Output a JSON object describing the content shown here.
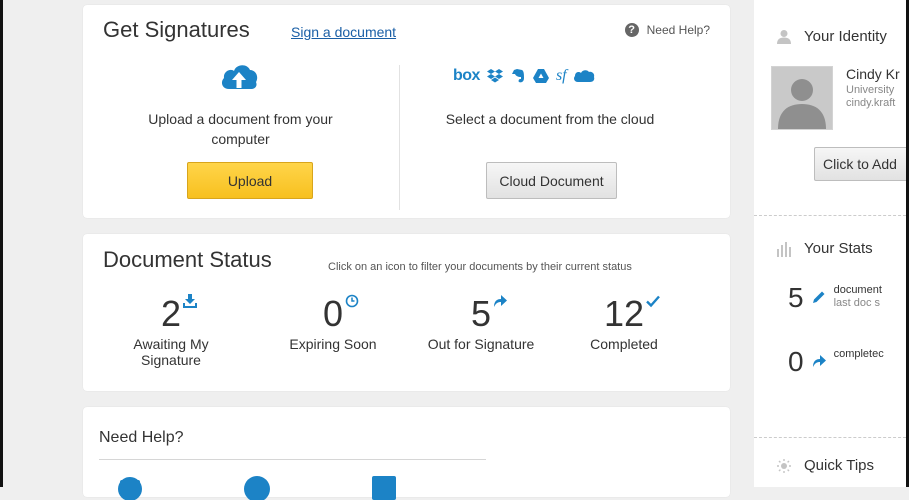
{
  "get_signatures": {
    "title": "Get Signatures",
    "sign_link": "Sign a document",
    "help_label": "Need Help?",
    "help_icon": "?",
    "upload_text": "Upload a document from your computer",
    "upload_button": "Upload",
    "cloud_text": "Select a document from the cloud",
    "cloud_button": "Cloud Document",
    "cloud_providers": [
      "box",
      "dropbox-icon",
      "evernote-icon",
      "google-drive-icon",
      "sharefile-icon",
      "salesforce-icon"
    ],
    "box_label": "box",
    "sharefile_label": "sf"
  },
  "document_status": {
    "title": "Document Status",
    "hint": "Click on an icon to filter your documents by their current status",
    "stats": [
      {
        "count": "2",
        "label": "Awaiting My Signature",
        "icon": "inbox-download-icon"
      },
      {
        "count": "0",
        "label": "Expiring Soon",
        "icon": "clock-icon"
      },
      {
        "count": "5",
        "label": "Out for Signature",
        "icon": "forward-arrow-icon"
      },
      {
        "count": "12",
        "label": "Completed",
        "icon": "checkmark-icon"
      }
    ]
  },
  "need_help": {
    "title": "Need Help?"
  },
  "sidebar": {
    "identity_title": "Your Identity",
    "name": "Cindy Kr",
    "org": "University",
    "email": "cindy.kraft",
    "add_button": "Click to Add",
    "stats_title": "Your Stats",
    "stat1_num": "5",
    "stat1_text": "document",
    "stat1_sub": "last doc s",
    "stat2_num": "0",
    "stat2_text": "completec",
    "tips_title": "Quick Tips"
  },
  "colors": {
    "accent_blue": "#1c83c6",
    "upload_yellow": "#f7c01f",
    "link_blue": "#1a5fa6"
  }
}
